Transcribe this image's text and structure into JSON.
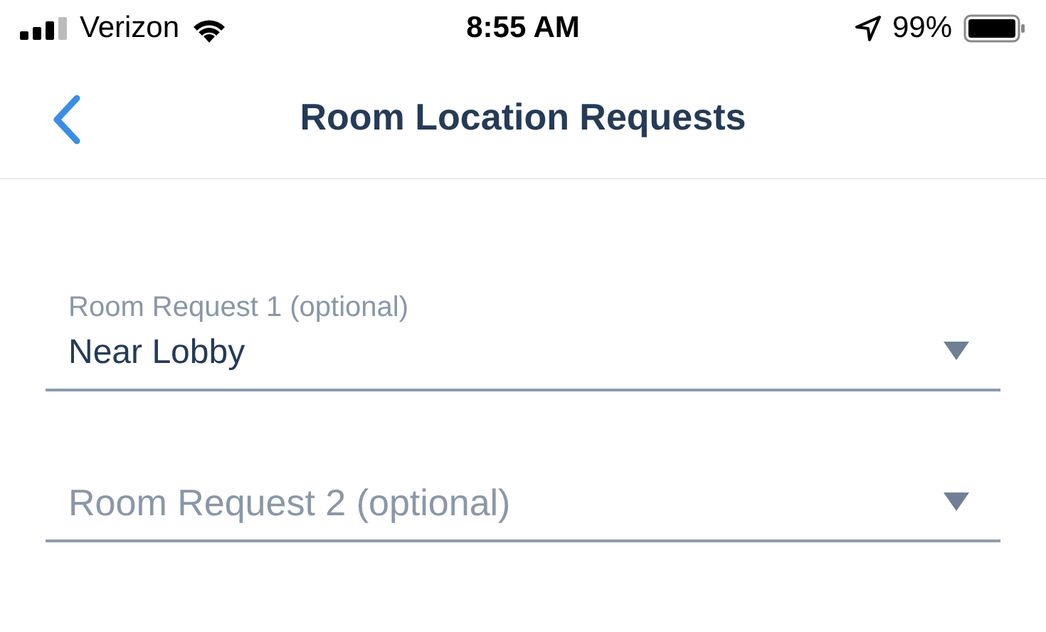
{
  "status_bar": {
    "carrier": "Verizon",
    "time": "8:55 AM",
    "battery": "99%"
  },
  "nav": {
    "title": "Room Location Requests"
  },
  "fields": [
    {
      "label": "Room Request 1 (optional)",
      "value": "Near Lobby"
    },
    {
      "placeholder": "Room Request 2 (optional)"
    }
  ]
}
